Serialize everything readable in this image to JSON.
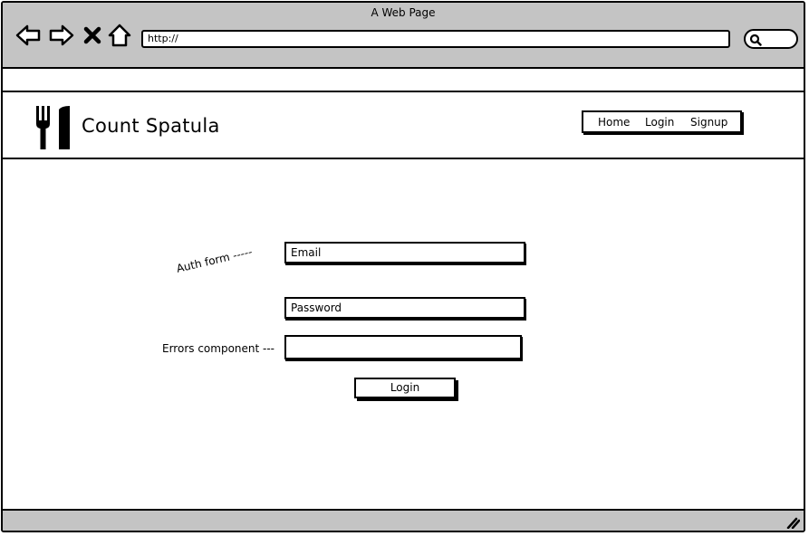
{
  "browser": {
    "window_title": "A Web Page",
    "url": "http://",
    "icons": {
      "back": "back-arrow-icon",
      "forward": "forward-arrow-icon",
      "stop": "close-icon",
      "home": "home-icon",
      "search": "search-icon"
    }
  },
  "site": {
    "brand": "Count Spatula",
    "logo_icon": "fork-knife-icon",
    "nav": [
      "Home",
      "Login",
      "Signup"
    ]
  },
  "form": {
    "email_placeholder": "Email",
    "password_placeholder": "Password",
    "errors_value": "",
    "login_label": "Login"
  },
  "annotations": {
    "auth_form": "Auth form -----",
    "errors_component": "Errors component ---"
  },
  "colors": {
    "chrome": "#c4c4c4",
    "stroke": "#000000",
    "background": "#ffffff"
  }
}
